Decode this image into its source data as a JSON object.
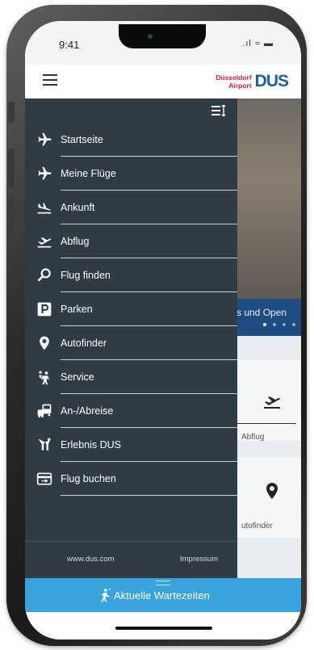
{
  "status_bar": {
    "time": "9:41",
    "icons": ".ıl ≈ ▬"
  },
  "header": {
    "logo_line1": "Düsseldorf",
    "logo_line2": "Airport",
    "logo_mark": "DUS"
  },
  "background": {
    "banner_text": "s und Open",
    "tiles": [
      {
        "label": "Abflug",
        "icon": "airplane-takeoff-icon"
      },
      {
        "label": "utofinder",
        "icon": "map-pin-icon"
      }
    ]
  },
  "drawer": {
    "items": [
      {
        "label": "Startseite",
        "icon": "airplane-icon"
      },
      {
        "label": "Meine Flüge",
        "icon": "airplane-right-icon"
      },
      {
        "label": "Ankunft",
        "icon": "airplane-landing-icon"
      },
      {
        "label": "Abflug",
        "icon": "airplane-takeoff-icon"
      },
      {
        "label": "Flug finden",
        "icon": "search-icon"
      },
      {
        "label": "Parken",
        "icon": "parking-icon"
      },
      {
        "label": "Autofinder",
        "icon": "map-pin-icon"
      },
      {
        "label": "Service",
        "icon": "service-people-icon"
      },
      {
        "label": "An-/Abreise",
        "icon": "bus-icon"
      },
      {
        "label": "Erlebnis DUS",
        "icon": "experience-icon"
      },
      {
        "label": "Flug buchen",
        "icon": "credit-card-icon"
      }
    ],
    "footer": {
      "website": "www.dus.com",
      "imprint": "Impressum"
    }
  },
  "wait_bar": {
    "label": "Aktuelle Wartezeiten",
    "icon": "person-walking-icon"
  },
  "colors": {
    "drawer_bg": "#2f3b45",
    "wait_bar": "#39a3dc",
    "brand_red": "#cf1f3c",
    "brand_blue": "#1b5fa8",
    "banner": "#1f4d83"
  }
}
